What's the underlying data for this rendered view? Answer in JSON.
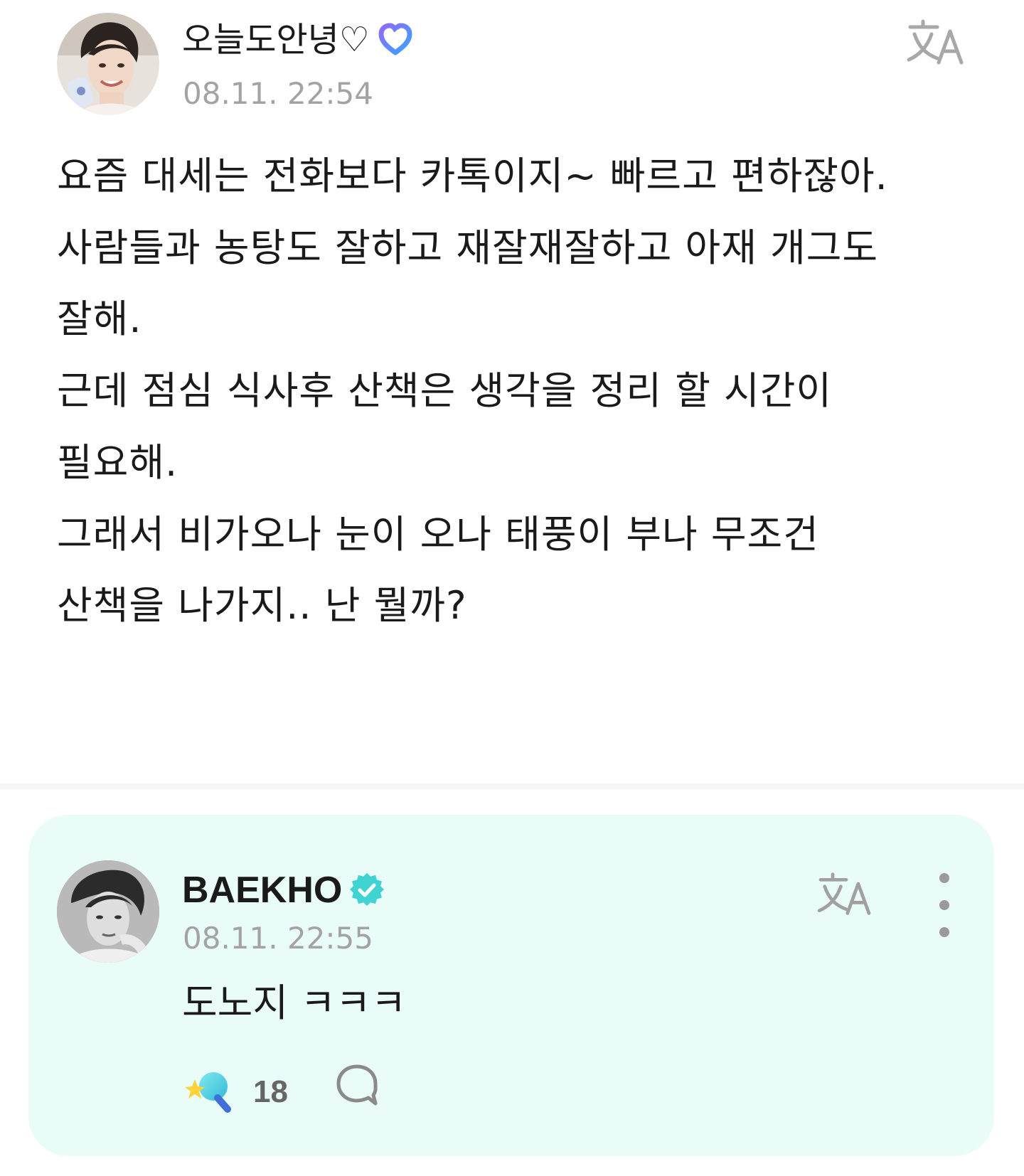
{
  "post": {
    "author": "오늘도안녕♡",
    "timestamp": "08.11. 22:54",
    "body": "요즘 대세는 전화보다 카톡이지~ 빠르고 편하잖아.\n사람들과 농탕도 잘하고 재잘재잘하고 아재 개그도\n잘해.\n근데 점심 식사후 산책은 생각을 정리 할 시간이\n필요해.\n그래서 비가오나 눈이 오나 태풍이 부나 무조건\n산책을 나가지.. 난 뭘까?",
    "icons": {
      "avatar": "user-avatar",
      "badge": "fan-badge-icon",
      "translate": "translate-icon"
    }
  },
  "comment": {
    "author": "BAEKHO",
    "timestamp": "08.11. 22:55",
    "text": "도노지 ㅋㅋㅋ",
    "reaction_count": "18",
    "colors": {
      "card_background": "#e9fcf7",
      "verified_badge": "#3fd4d2"
    },
    "icons": {
      "avatar": "artist-avatar",
      "verified": "verified-badge-icon",
      "translate": "translate-icon",
      "more": "more-options-icon",
      "reaction": "reaction-icon",
      "reply": "reply-icon"
    }
  }
}
